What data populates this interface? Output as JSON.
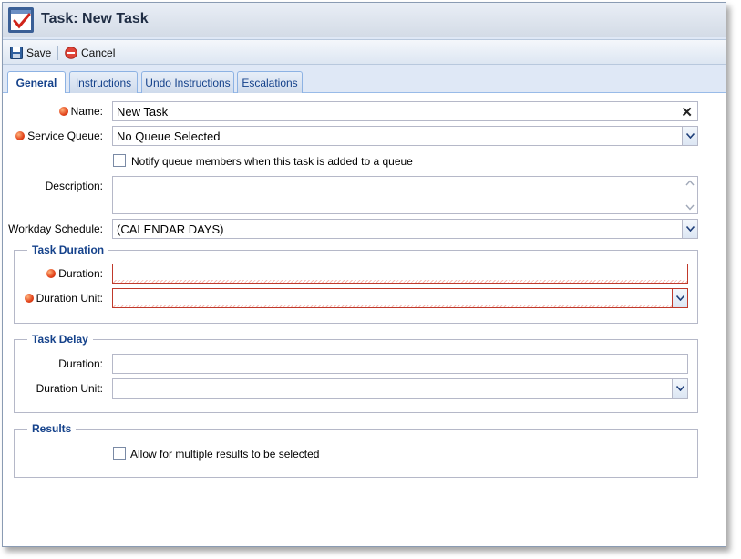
{
  "window": {
    "title": "Task: New Task"
  },
  "toolbar": {
    "save_label": "Save",
    "cancel_label": "Cancel"
  },
  "tabs": [
    {
      "label": "General",
      "active": true
    },
    {
      "label": "Instructions",
      "active": false
    },
    {
      "label": "Undo Instructions",
      "active": false
    },
    {
      "label": "Escalations",
      "active": false
    }
  ],
  "form": {
    "name_label": "Name:",
    "name_value": "New Task",
    "service_queue_label": "Service Queue:",
    "service_queue_value": "No Queue Selected",
    "notify_label": "Notify queue members when this task is added to a queue",
    "description_label": "Description:",
    "description_value": "",
    "workday_label": "Workday Schedule:",
    "workday_value": "(CALENDAR DAYS)"
  },
  "task_duration": {
    "legend": "Task Duration",
    "duration_label": "Duration:",
    "duration_value": "",
    "unit_label": "Duration Unit:",
    "unit_value": ""
  },
  "task_delay": {
    "legend": "Task Delay",
    "duration_label": "Duration:",
    "duration_value": "",
    "unit_label": "Duration Unit:",
    "unit_value": ""
  },
  "results": {
    "legend": "Results",
    "multiple_label": "Allow for multiple results to be selected"
  },
  "colors": {
    "accent": "#15428b",
    "required": "#e2421a",
    "window_bg": "#dfe8f6"
  }
}
